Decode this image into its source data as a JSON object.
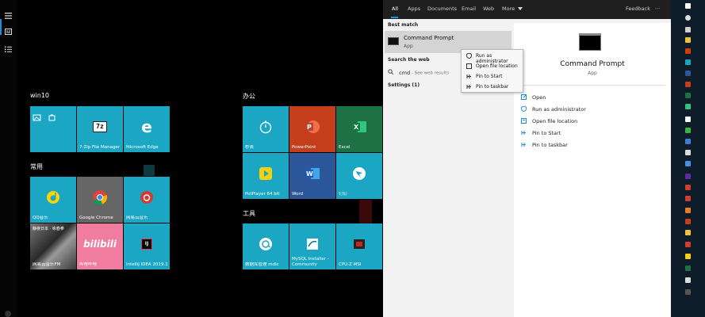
{
  "groups": {
    "win10": "win10",
    "changyong": "常用",
    "bangong": "办公",
    "gongju": "工具"
  },
  "tiles": [
    {
      "id": "photos",
      "label": ""
    },
    {
      "id": "7zip",
      "label": "7-Zip File Manager"
    },
    {
      "id": "edge",
      "label": "Microsoft Edge"
    },
    {
      "id": "timer",
      "label": "秒表"
    },
    {
      "id": "powerpoint",
      "label": "PowerPoint"
    },
    {
      "id": "excel",
      "label": "Excel"
    },
    {
      "id": "potplayer",
      "label": "PotPlayer 64 bit"
    },
    {
      "id": "word",
      "label": "Word"
    },
    {
      "id": "dingding",
      "label": "钉钉"
    },
    {
      "id": "qqmusic",
      "label": "QQ音乐"
    },
    {
      "id": "chrome",
      "label": "Google Chrome"
    },
    {
      "id": "netease",
      "label": "网易云音乐"
    },
    {
      "id": "neteasefm",
      "label": "网易云音乐FM"
    },
    {
      "id": "bilibili",
      "label": "哔哩哔哩"
    },
    {
      "id": "idea",
      "label": "IntelliJ IDEA 2019.1.3"
    },
    {
      "id": "mydb",
      "label": "数据库管理 mdic"
    },
    {
      "id": "mysql",
      "label": "MySQL Installer - Community"
    },
    {
      "id": "cpuz",
      "label": "CPU-Z MSI"
    }
  ],
  "tile_extra": {
    "photo_caption": "静夜日本 · 咏春拳"
  },
  "search": {
    "tabs": [
      "All",
      "Apps",
      "Documents",
      "Email",
      "Web",
      "More"
    ],
    "feedback": "Feedback",
    "more_dots": "···",
    "best_match_header": "Best match",
    "best_match_title": "Command Prompt",
    "best_match_subtitle": "App",
    "web_header": "Search the web",
    "web_query": "cmd",
    "web_hint": " - See web results",
    "settings": "Settings (1)",
    "detail_title": "Command Prompt",
    "detail_subtitle": "App",
    "detail_actions": [
      "Open",
      "Run as administrator",
      "Open file location",
      "Pin to Start",
      "Pin to taskbar"
    ],
    "context_menu": [
      "Run as administrator",
      "Open file location",
      "Pin to Start",
      "Pin to taskbar"
    ]
  },
  "colors": {
    "accent": "#1e8de0",
    "tile_teal": "#1ba7c4",
    "powerpoint": "#c43e1c",
    "excel": "#1e7145",
    "word": "#2b579a"
  }
}
